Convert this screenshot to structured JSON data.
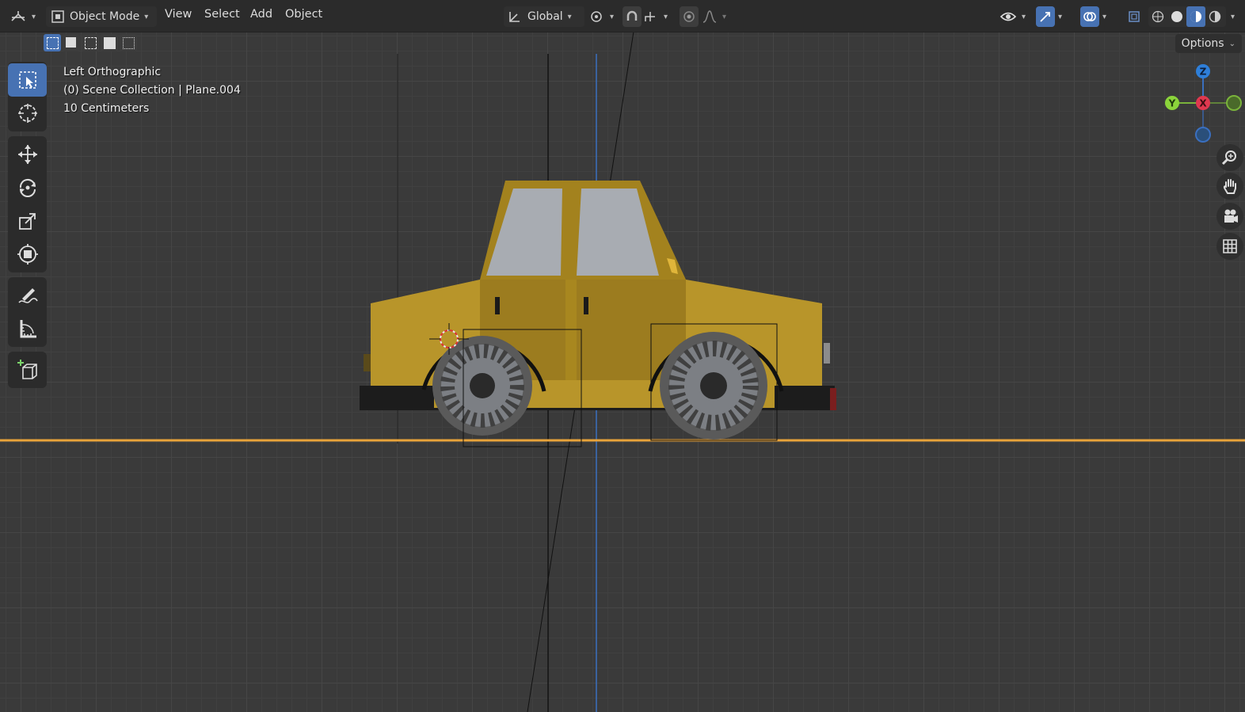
{
  "header": {
    "editor_type_icon": "axis-editor-icon",
    "mode_label": "Object Mode",
    "menus": [
      "View",
      "Select",
      "Add",
      "Object"
    ],
    "transform_orientation": "Global",
    "options_label": "Options"
  },
  "overlay": {
    "view_name": "Left Orthographic",
    "collection_info": "(0) Scene Collection | Plane.004",
    "grid_scale": "10 Centimeters"
  },
  "gizmo": {
    "z": "Z",
    "x": "X",
    "y": "Y"
  },
  "toolbar": {
    "tools": [
      "select-box",
      "cursor",
      "move",
      "rotate",
      "scale",
      "transform",
      "annotate",
      "measure",
      "add-cube"
    ]
  },
  "colors": {
    "car_body": "#b8952a",
    "car_dark": "#8a6d1c",
    "window": "#a8acb2",
    "accent_orange": "#e8a33a",
    "axis_blue": "#3a6fbf",
    "select_blue": "#4772b3"
  }
}
